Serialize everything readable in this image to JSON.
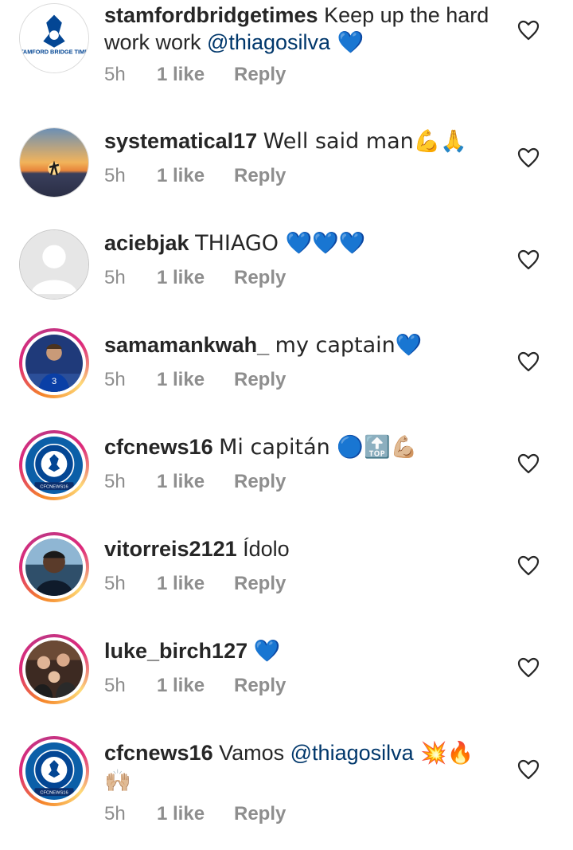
{
  "comments": [
    {
      "username": "stamfordbridgetimes",
      "text_parts": [
        "Keep up the hard work work ",
        "@thiagosilva",
        " 💙"
      ],
      "time": "5h",
      "likes": "1 like",
      "reply": "Reply",
      "avatar": "stamford-bridge-times-logo",
      "avatar_text": "STAMFORD BRIDGE TIMES",
      "ring": false
    },
    {
      "username": "systematical17",
      "text_parts": [
        "Well said man💪🙏"
      ],
      "time": "5h",
      "likes": "1 like",
      "reply": "Reply",
      "avatar": "sunset-photo",
      "ring": false
    },
    {
      "username": "aciebjak",
      "text_parts": [
        "THIAGO 💙💙💙"
      ],
      "time": "5h",
      "likes": "1 like",
      "reply": "Reply",
      "avatar": "default-avatar",
      "ring": false
    },
    {
      "username": "samamankwah_",
      "text_parts": [
        "my captain💙"
      ],
      "time": "5h",
      "likes": "1 like",
      "reply": "Reply",
      "avatar": "player-photo",
      "ring": true
    },
    {
      "username": "cfcnews16",
      "text_parts": [
        "Mi capitán 🔵🔝💪🏼"
      ],
      "time": "5h",
      "likes": "1 like",
      "reply": "Reply",
      "avatar": "chelsea-crest",
      "avatar_text": "CFCNEWS16",
      "ring": true
    },
    {
      "username": "vitorreis2121",
      "text_parts": [
        "Ídolo"
      ],
      "time": "5h",
      "likes": "1 like",
      "reply": "Reply",
      "avatar": "portrait-photo",
      "ring": true
    },
    {
      "username": "luke_birch127",
      "text_parts": [
        "💙"
      ],
      "time": "5h",
      "likes": "1 like",
      "reply": "Reply",
      "avatar": "group-photo",
      "ring": true
    },
    {
      "username": "cfcnews16",
      "text_parts": [
        "Vamos ",
        "@thiagosilva",
        " 💥🔥 🙌🏼"
      ],
      "time": "5h",
      "likes": "1 like",
      "reply": "Reply",
      "avatar": "chelsea-crest",
      "avatar_text": "CFCNEWS16",
      "ring": true
    }
  ],
  "colors": {
    "text": "#262626",
    "meta": "#8e8e8e",
    "mention": "#00376b",
    "chelsea_blue": "#034694"
  },
  "icons": {
    "like": "heart-outline-icon"
  }
}
